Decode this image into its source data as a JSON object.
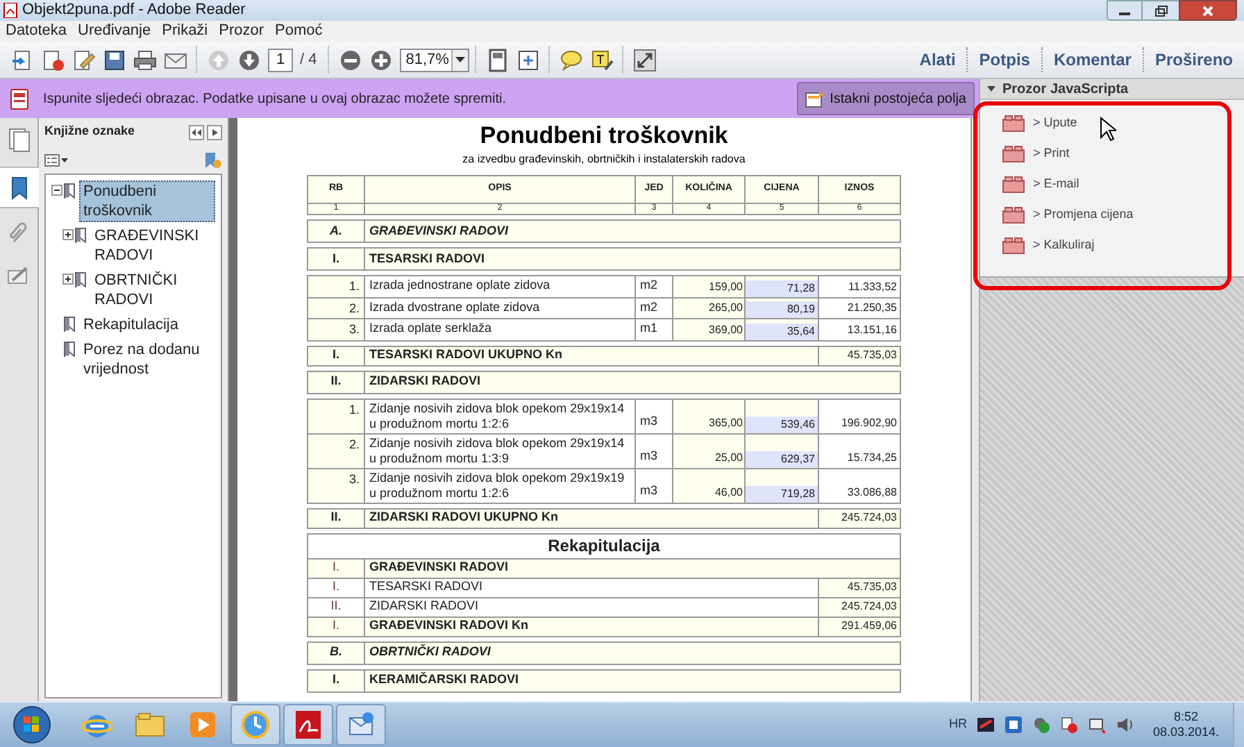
{
  "window": {
    "title": "Objekt2puna.pdf - Adobe Reader"
  },
  "menu": [
    "Datoteka",
    "Uređivanje",
    "Prikaži",
    "Prozor",
    "Pomoć"
  ],
  "toolbar": {
    "page": "1",
    "page_total": "/ 4",
    "zoom": "81,7%",
    "tabs": [
      "Alati",
      "Potpis",
      "Komentar",
      "Prošireno"
    ]
  },
  "form_bar": {
    "message": "Ispunite sljedeći obrazac. Podatke upisane u ovaj obrazac možete spremiti.",
    "button": "Istakni postojeća polja"
  },
  "bookmarks": {
    "title": "Knjižne oznake",
    "items": [
      {
        "label": "Ponudbeni troškovnik",
        "selected": true,
        "expanded": true,
        "children": [
          {
            "label": "GRAĐEVINSKI RADOVI",
            "selected": false,
            "expanded": false
          },
          {
            "label": "OBRTNIČKI RADOVI",
            "selected": false,
            "expanded": false
          }
        ]
      },
      {
        "label": "Rekapitulacija",
        "selected": false
      },
      {
        "label": "Porez na dodanu vrijednost",
        "selected": false
      }
    ]
  },
  "document": {
    "title": "Ponudbeni troškovnik",
    "subtitle": "za izvedbu građevinskih, obrtničkih i instalaterskih radova",
    "columns": [
      "RB",
      "OPIS",
      "JED",
      "KOLIČINA",
      "CIJENA",
      "IZNOS"
    ],
    "column_numbers": [
      "1",
      "2",
      "3",
      "4",
      "5",
      "6"
    ],
    "blocks": [
      {
        "kind": "group",
        "rb": "A.",
        "text": "GRAĐEVINSKI RADOVI"
      },
      {
        "kind": "section",
        "rb": "I.",
        "text": "TESARSKI RADOVI"
      },
      {
        "kind": "items",
        "rows": [
          {
            "rb": "1.",
            "opis": "Izrada jednostrane oplate zidova",
            "jed": "m2",
            "kolicina": "159,00",
            "cijena": "71,28",
            "iznos": "11.333,52"
          },
          {
            "rb": "2.",
            "opis": "Izrada dvostrane oplate zidova",
            "jed": "m2",
            "kolicina": "265,00",
            "cijena": "80,19",
            "iznos": "21.250,35"
          },
          {
            "rb": "3.",
            "opis": "Izrada oplate serklaža",
            "jed": "m1",
            "kolicina": "369,00",
            "cijena": "35,64",
            "iznos": "13.151,16"
          }
        ]
      },
      {
        "kind": "total",
        "rb": "I.",
        "text": "TESARSKI RADOVI UKUPNO Kn",
        "iznos": "45.735,03"
      },
      {
        "kind": "section",
        "rb": "II.",
        "text": "ZIDARSKI RADOVI"
      },
      {
        "kind": "items",
        "rows": [
          {
            "rb": "1.",
            "opis": "Zidanje nosivih zidova blok opekom 29x19x14 u produžnom mortu 1:2:6",
            "jed": "m3",
            "kolicina": "365,00",
            "cijena": "539,46",
            "iznos": "196.902,90"
          },
          {
            "rb": "2.",
            "opis": "Zidanje nosivih zidova blok opekom 29x19x14 u produžnom mortu 1:3:9",
            "jed": "m3",
            "kolicina": "25,00",
            "cijena": "629,37",
            "iznos": "15.734,25"
          },
          {
            "rb": "3.",
            "opis": "Zidanje nosivih zidova blok opekom 29x19x19 u produžnom mortu 1:2:6",
            "jed": "m3",
            "kolicina": "46,00",
            "cijena": "719,28",
            "iznos": "33.086,88"
          }
        ]
      },
      {
        "kind": "total",
        "rb": "II.",
        "text": "ZIDARSKI RADOVI UKUPNO Kn",
        "iznos": "245.724,03"
      },
      {
        "kind": "recap",
        "title": "Rekapitulacija",
        "rows": [
          {
            "rb": "I.",
            "text": "GRAĐEVINSKI RADOVI",
            "bold": true
          },
          {
            "rb": "I.",
            "text": "TESARSKI RADOVI",
            "bold": false,
            "iznos": "45.735,03"
          },
          {
            "rb": "II.",
            "text": "ZIDARSKI RADOVI",
            "bold": false,
            "iznos": "245.724,03"
          },
          {
            "rb": "I.",
            "text": "GRAĐEVINSKI RADOVI Kn",
            "bold": true,
            "iznos": "291.459,06"
          }
        ]
      },
      {
        "kind": "group",
        "rb": "B.",
        "text": "OBRTNIČKI RADOVI"
      },
      {
        "kind": "section",
        "rb": "I.",
        "text": "KERAMIČARSKI RADOVI"
      }
    ]
  },
  "js_panel": {
    "title": "Prozor JavaScripta",
    "items": [
      "> Upute",
      "> Print",
      "> E-mail",
      "> Promjena cijena",
      "> Kalkuliraj"
    ]
  },
  "taskbar": {
    "language": "HR",
    "time": "8:52",
    "date": "08.03.2014."
  }
}
